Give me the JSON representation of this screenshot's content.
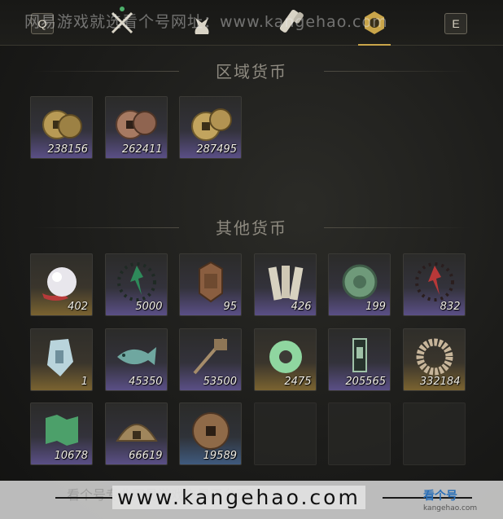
{
  "header": {
    "key_left": "Q",
    "key_right": "E",
    "tabs": [
      {
        "name": "weapons-tab",
        "icon": "crossed-swords-icon"
      },
      {
        "name": "pouch-tab",
        "icon": "pouch-icon"
      },
      {
        "name": "scrolls-tab",
        "icon": "scroll-icon"
      },
      {
        "name": "currency-tab",
        "icon": "currency-icon",
        "active": true
      }
    ],
    "watermark": "网易游戏就选看个号网址：www.kangehao.com"
  },
  "sections": {
    "regional": {
      "title": "区域货币"
    },
    "other": {
      "title": "其他货币"
    }
  },
  "regional_items": [
    {
      "icon": "gold-coins-icon",
      "count": "238156",
      "rarity": "purple"
    },
    {
      "icon": "copper-coins-icon",
      "count": "262411",
      "rarity": "purple"
    },
    {
      "icon": "gold-coins-stack-icon",
      "count": "287495",
      "rarity": "purple"
    }
  ],
  "other_items": [
    {
      "icon": "pearl-icon",
      "count": "402",
      "rarity": "gold"
    },
    {
      "icon": "red-jade-token-icon",
      "count": "5000",
      "rarity": "purple"
    },
    {
      "icon": "bronze-plaque-icon",
      "count": "95",
      "rarity": "purple"
    },
    {
      "icon": "bamboo-slips-icon",
      "count": "426",
      "rarity": "purple"
    },
    {
      "icon": "jade-disc-icon",
      "count": "199",
      "rarity": "purple"
    },
    {
      "icon": "red-token-icon",
      "count": "832",
      "rarity": "purple"
    },
    {
      "icon": "jade-stone-icon",
      "count": "1",
      "rarity": "gold"
    },
    {
      "icon": "jade-fish-icon",
      "count": "45350",
      "rarity": "purple"
    },
    {
      "icon": "key-sword-icon",
      "count": "53500",
      "rarity": "purple"
    },
    {
      "icon": "jade-ring-icon",
      "count": "2475",
      "rarity": "gold"
    },
    {
      "icon": "jade-tablet-icon",
      "count": "205565",
      "rarity": "purple"
    },
    {
      "icon": "beaded-bracelet-icon",
      "count": "332184",
      "rarity": "gold"
    },
    {
      "icon": "jade-map-icon",
      "count": "10678",
      "rarity": "purple"
    },
    {
      "icon": "half-coin-icon",
      "count": "66619",
      "rarity": "purple"
    },
    {
      "icon": "square-hole-coin-icon",
      "count": "19589",
      "rarity": "blue"
    },
    {
      "icon": "",
      "count": "",
      "rarity": "empty"
    },
    {
      "icon": "",
      "count": "",
      "rarity": "empty"
    },
    {
      "icon": "",
      "count": "",
      "rarity": "empty"
    }
  ],
  "footer": {
    "url": "www.kangehao.com",
    "faint_text": "看个号专业网易游戏交易平台百亿",
    "logo_text": "看个号",
    "logo_sub": "kangehao.com"
  }
}
